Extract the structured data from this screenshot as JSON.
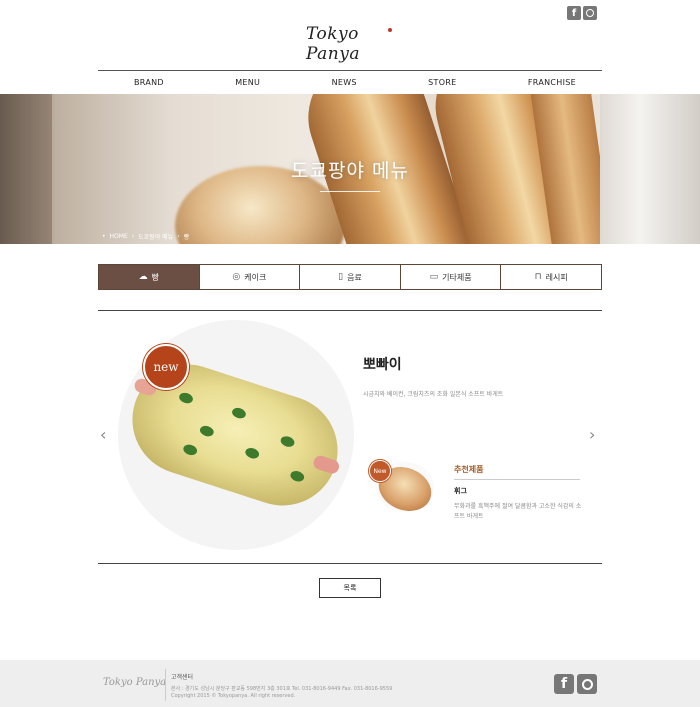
{
  "header": {
    "logo_text": "Tokyo Panya",
    "social": [
      "facebook-icon",
      "instagram-icon"
    ]
  },
  "nav": [
    "BRAND",
    "MENU",
    "NEWS",
    "STORE",
    "FRANCHISE"
  ],
  "hero": {
    "title": "도쿄팡야 메뉴",
    "breadcrumb": [
      "HOME",
      "도쿄팡야 메뉴",
      "빵"
    ]
  },
  "tabs": [
    {
      "label": "빵",
      "icon": "bread-icon",
      "selected": true
    },
    {
      "label": "케이크",
      "icon": "cake-icon",
      "selected": false
    },
    {
      "label": "음료",
      "icon": "drink-icon",
      "selected": false
    },
    {
      "label": "기타제품",
      "icon": "product-icon",
      "selected": false
    },
    {
      "label": "레시피",
      "icon": "recipe-icon",
      "selected": false
    }
  ],
  "product": {
    "badge": "new",
    "name": "뽀빠이",
    "description": "시금치와 베이컨, 크림치즈의 조화 일본식 소프트 바게트"
  },
  "recommended": {
    "badge": "New",
    "title": "추천제품",
    "name": "휘그",
    "description": "무화과를 흑맥주에 절여 달콤함과 고소한 식감의 소프트 바게트"
  },
  "list_button": "목록",
  "footer": {
    "logo_text": "Tokyo Panya",
    "title": "고객센터",
    "address": "본사 : 경기도 성남시 분당구 판교동 598번지 3층 301호  Tel. 031-8016-9449  Fax. 031-8016-9559",
    "copyright": "Copyright 2015 © Tokyopanya. All right reserved."
  },
  "colors": {
    "tab_active_bg": "#6b4f44",
    "badge": "#b6441a",
    "accent_text": "#a55b25"
  }
}
